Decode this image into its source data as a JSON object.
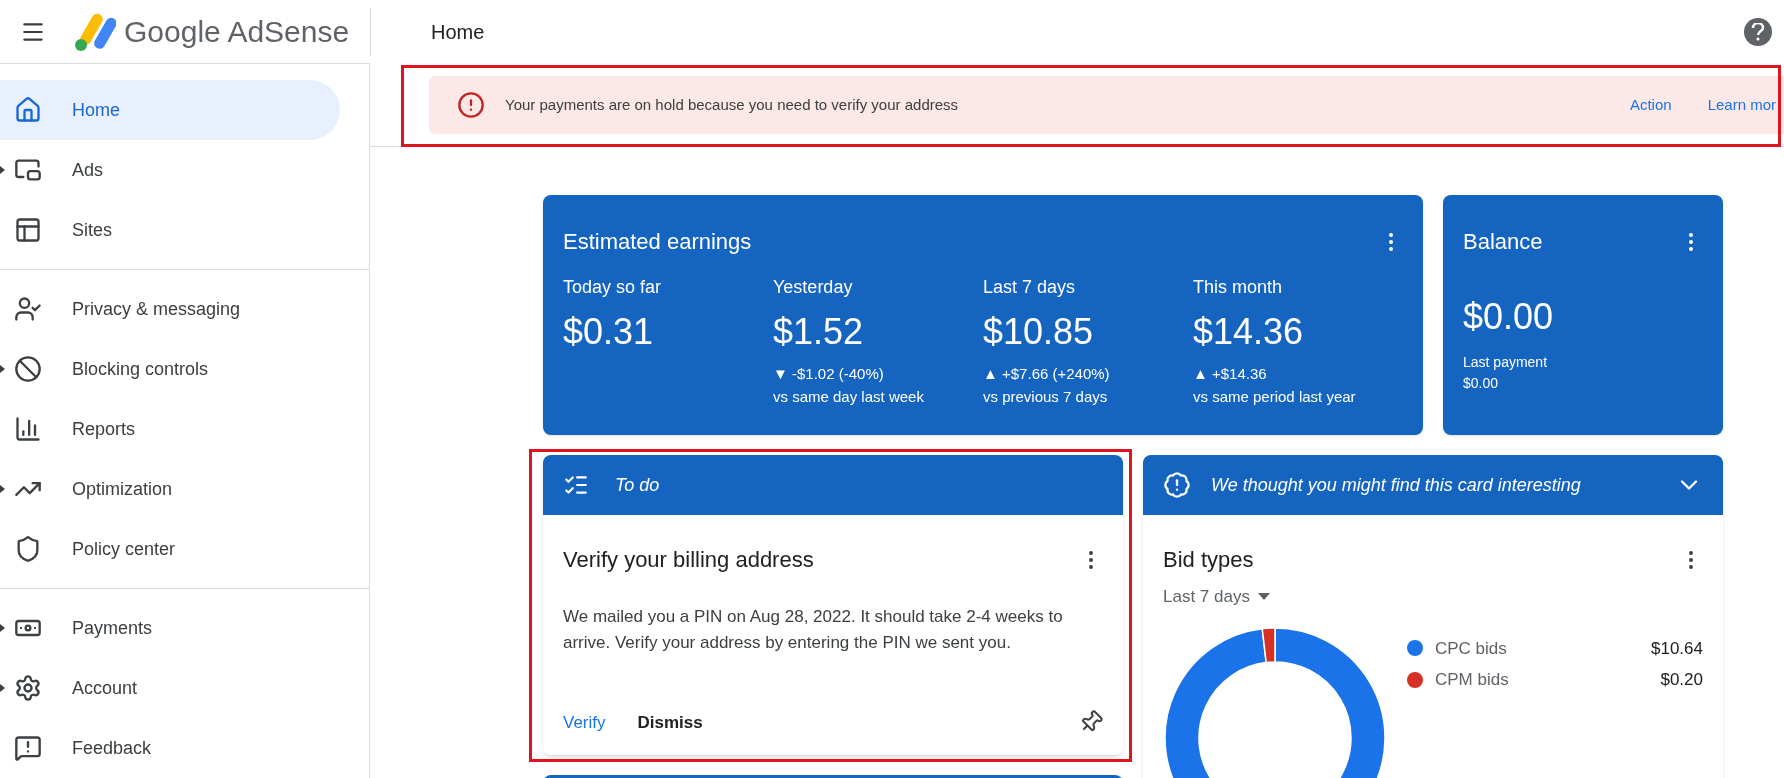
{
  "header": {
    "product": "Google AdSense",
    "page_title": "Home"
  },
  "sidebar": {
    "items": [
      {
        "label": "Home",
        "selected": true,
        "expandable": false
      },
      {
        "label": "Ads",
        "selected": false,
        "expandable": true
      },
      {
        "label": "Sites",
        "selected": false,
        "expandable": false
      },
      {
        "label": "Privacy & messaging",
        "selected": false,
        "expandable": false
      },
      {
        "label": "Blocking controls",
        "selected": false,
        "expandable": true
      },
      {
        "label": "Reports",
        "selected": false,
        "expandable": false
      },
      {
        "label": "Optimization",
        "selected": false,
        "expandable": true
      },
      {
        "label": "Policy center",
        "selected": false,
        "expandable": false
      },
      {
        "label": "Payments",
        "selected": false,
        "expandable": true
      },
      {
        "label": "Account",
        "selected": false,
        "expandable": true
      },
      {
        "label": "Feedback",
        "selected": false,
        "expandable": false
      }
    ]
  },
  "alert": {
    "message": "Your payments are on hold because you need to verify your address",
    "actions": [
      "Action",
      "Learn mor"
    ]
  },
  "earnings": {
    "title": "Estimated earnings",
    "periods": [
      {
        "label": "Today so far",
        "value": "$0.31"
      },
      {
        "label": "Yesterday",
        "value": "$1.52",
        "change": "▼ -$1.02 (-40%)",
        "comparison": "vs same day last week"
      },
      {
        "label": "Last 7 days",
        "value": "$10.85",
        "change": "▲ +$7.66 (+240%)",
        "comparison": "vs previous 7 days"
      },
      {
        "label": "This month",
        "value": "$14.36",
        "change": "▲ +$14.36",
        "comparison": "vs same period last year"
      }
    ]
  },
  "balance": {
    "title": "Balance",
    "value": "$0.00",
    "last_payment_label": "Last payment",
    "last_payment": "$0.00"
  },
  "todo": {
    "header": "To do",
    "title": "Verify your billing address",
    "body": "We mailed you a PIN on Aug 28, 2022. It should take 2-4 weeks to arrive. Verify your address by entering the PIN we sent you.",
    "actions": [
      "Verify",
      "Dismiss"
    ]
  },
  "suggestion": {
    "header": "We thought you might find this card interesting",
    "title": "Bid types",
    "range": "Last 7 days",
    "legend": [
      {
        "value": "$10.64",
        "color": "#1a73e8"
      },
      {
        "value": "$0.20",
        "color": "#d93025"
      }
    ],
    "chart_data": {
      "type": "donut",
      "categories": [
        "CPC bids",
        "CPM bids"
      ],
      "values": [
        98.15,
        1.85
      ]
    }
  }
}
